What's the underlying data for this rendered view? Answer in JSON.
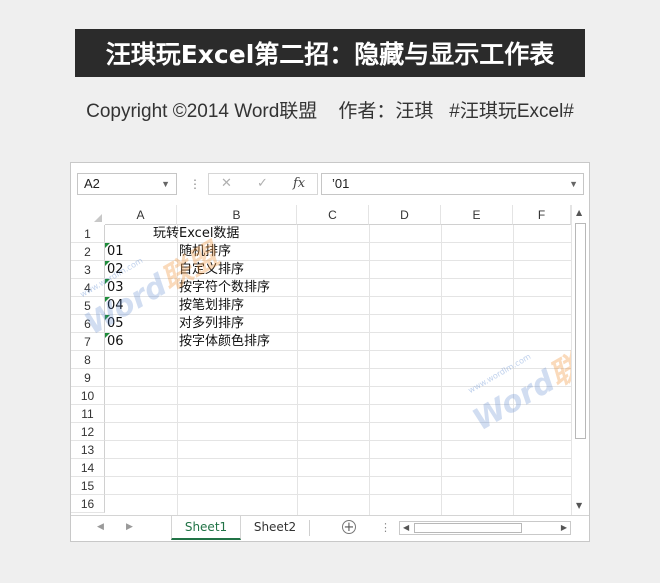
{
  "banner": {
    "title": "汪琪玩Excel第二招：隐藏与显示工作表"
  },
  "copyright": {
    "text": "Copyright ©2014 Word联盟",
    "author": "作者：汪琪",
    "tag": "#汪琪玩Excel#"
  },
  "formula_bar": {
    "name_box": "A2",
    "cancel_icon": "✕",
    "enter_icon": "✓",
    "fx_label": "fx",
    "formula_value": "’01"
  },
  "columns": [
    "A",
    "B",
    "C",
    "D",
    "E",
    "F"
  ],
  "rows": [
    "1",
    "2",
    "3",
    "4",
    "5",
    "6",
    "7",
    "8",
    "9",
    "10",
    "11",
    "12",
    "13",
    "14",
    "15",
    "16"
  ],
  "cells": {
    "header": "玩转Excel数据",
    "data": [
      {
        "a": "01",
        "b": "随机排序"
      },
      {
        "a": "02",
        "b": "自定义排序"
      },
      {
        "a": "03",
        "b": "按字符个数排序"
      },
      {
        "a": "04",
        "b": "按笔划排序"
      },
      {
        "a": "05",
        "b": "对多列排序"
      },
      {
        "a": "06",
        "b": "按字体颜色排序"
      }
    ]
  },
  "watermark": {
    "word": "Word",
    "league": "联盟",
    "url": "www.wordlm.com"
  },
  "sheet_tabs": {
    "prev": "◀",
    "next": "▶",
    "tabs": [
      "Sheet1",
      "Sheet2"
    ],
    "active": "Sheet1",
    "add": "+"
  },
  "colors": {
    "accent_green": "#217346",
    "banner_bg": "#2b2b2b"
  }
}
